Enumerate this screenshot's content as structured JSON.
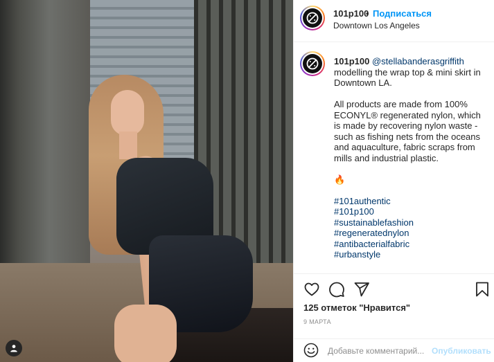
{
  "post": {
    "username": "101p100",
    "location": "Downtown Los Angeles",
    "follow_separator": "•",
    "follow_label": "Подписаться"
  },
  "caption": {
    "username": "101p100",
    "mention": "@stellabanderasgriffith",
    "line1": "modelling the wrap top & mini skirt in Downtown LA.",
    "paragraph2": "All products are made from 100% ECONYL® regenerated nylon, which is made by recovering nylon waste - such as fishing nets from the oceans and aquaculture, fabric scraps from mills and industrial plastic.",
    "emoji": "🔥",
    "hashtags": [
      "#101authentic",
      "#101p100",
      "#sustainablefashion",
      "#regeneratednylon",
      "#antibacterialfabric",
      "#urbanstyle"
    ]
  },
  "actions": {
    "likes_text": "125 отметок \"Нравится\"",
    "date_text": "9 МАРТА"
  },
  "comment": {
    "placeholder": "Добавьте комментарий...",
    "publish_label": "Опубликовать"
  },
  "icons": {
    "like": "heart-icon",
    "comment": "comment-icon",
    "share": "paper-plane-icon",
    "save": "bookmark-icon",
    "emoji": "smiley-icon",
    "tag": "user-tag-icon"
  },
  "colors": {
    "link_blue": "#0095f6",
    "hashtag": "#00376b",
    "publish_disabled": "#b2dffc",
    "muted": "#8e8e8e"
  }
}
